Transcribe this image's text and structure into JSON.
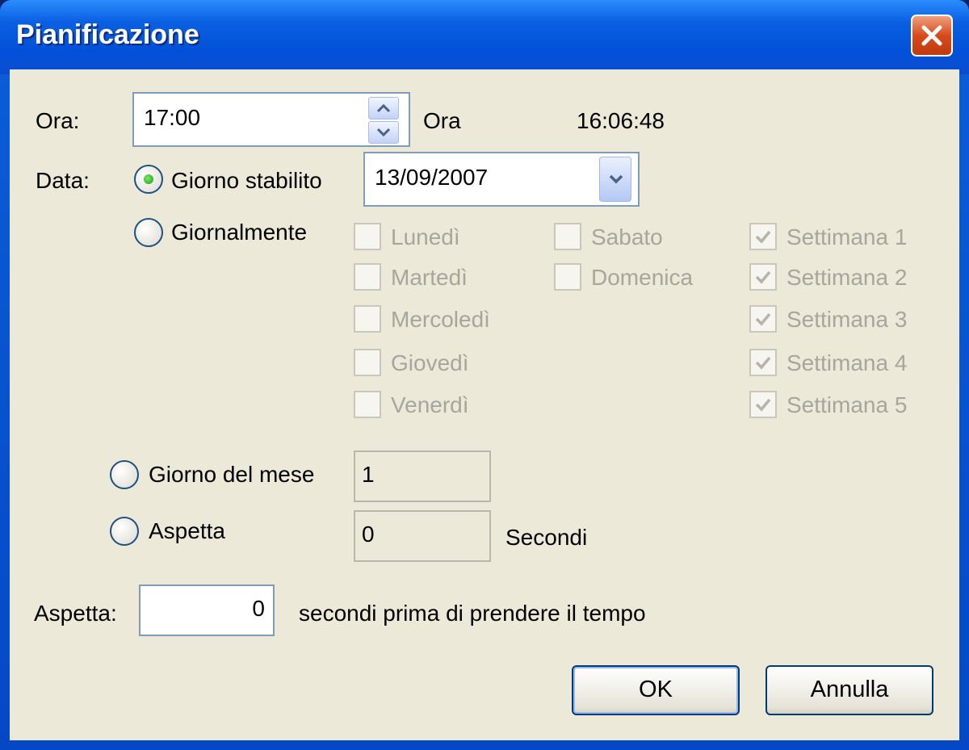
{
  "window": {
    "title": "Pianificazione"
  },
  "time": {
    "label": "Ora:",
    "value": "17:00",
    "current_label": "Ora",
    "current_value": "16:06:48"
  },
  "date": {
    "label": "Data:",
    "fixed_day_label": "Giorno stabilito",
    "fixed_day_value": "13/09/2007",
    "daily_label": "Giornalmente",
    "days": [
      {
        "label": "Lunedì",
        "checked": false
      },
      {
        "label": "Martedì",
        "checked": false
      },
      {
        "label": "Mercoledì",
        "checked": false
      },
      {
        "label": "Giovedì",
        "checked": false
      },
      {
        "label": "Venerdì",
        "checked": false
      },
      {
        "label": "Sabato",
        "checked": false
      },
      {
        "label": "Domenica",
        "checked": false
      }
    ],
    "weeks": [
      {
        "label": "Settimana 1",
        "checked": true
      },
      {
        "label": "Settimana 2",
        "checked": true
      },
      {
        "label": "Settimana 3",
        "checked": true
      },
      {
        "label": "Settimana 4",
        "checked": true
      },
      {
        "label": "Settimana 5",
        "checked": true
      }
    ],
    "month_day_label": "Giorno del mese",
    "month_day_value": "1",
    "wait_label": "Aspetta",
    "wait_value": "0",
    "wait_unit": "Secondi",
    "selected": "fixed_day"
  },
  "delay": {
    "label": "Aspetta:",
    "value": "0",
    "suffix": "secondi prima di prendere il tempo"
  },
  "buttons": {
    "ok": "OK",
    "cancel": "Annulla"
  },
  "colors": {
    "title_bar": "#0a5fe0",
    "client_bg": "#ece9d8",
    "disabled_text": "#a7a69c",
    "close": "#d84a1c"
  }
}
